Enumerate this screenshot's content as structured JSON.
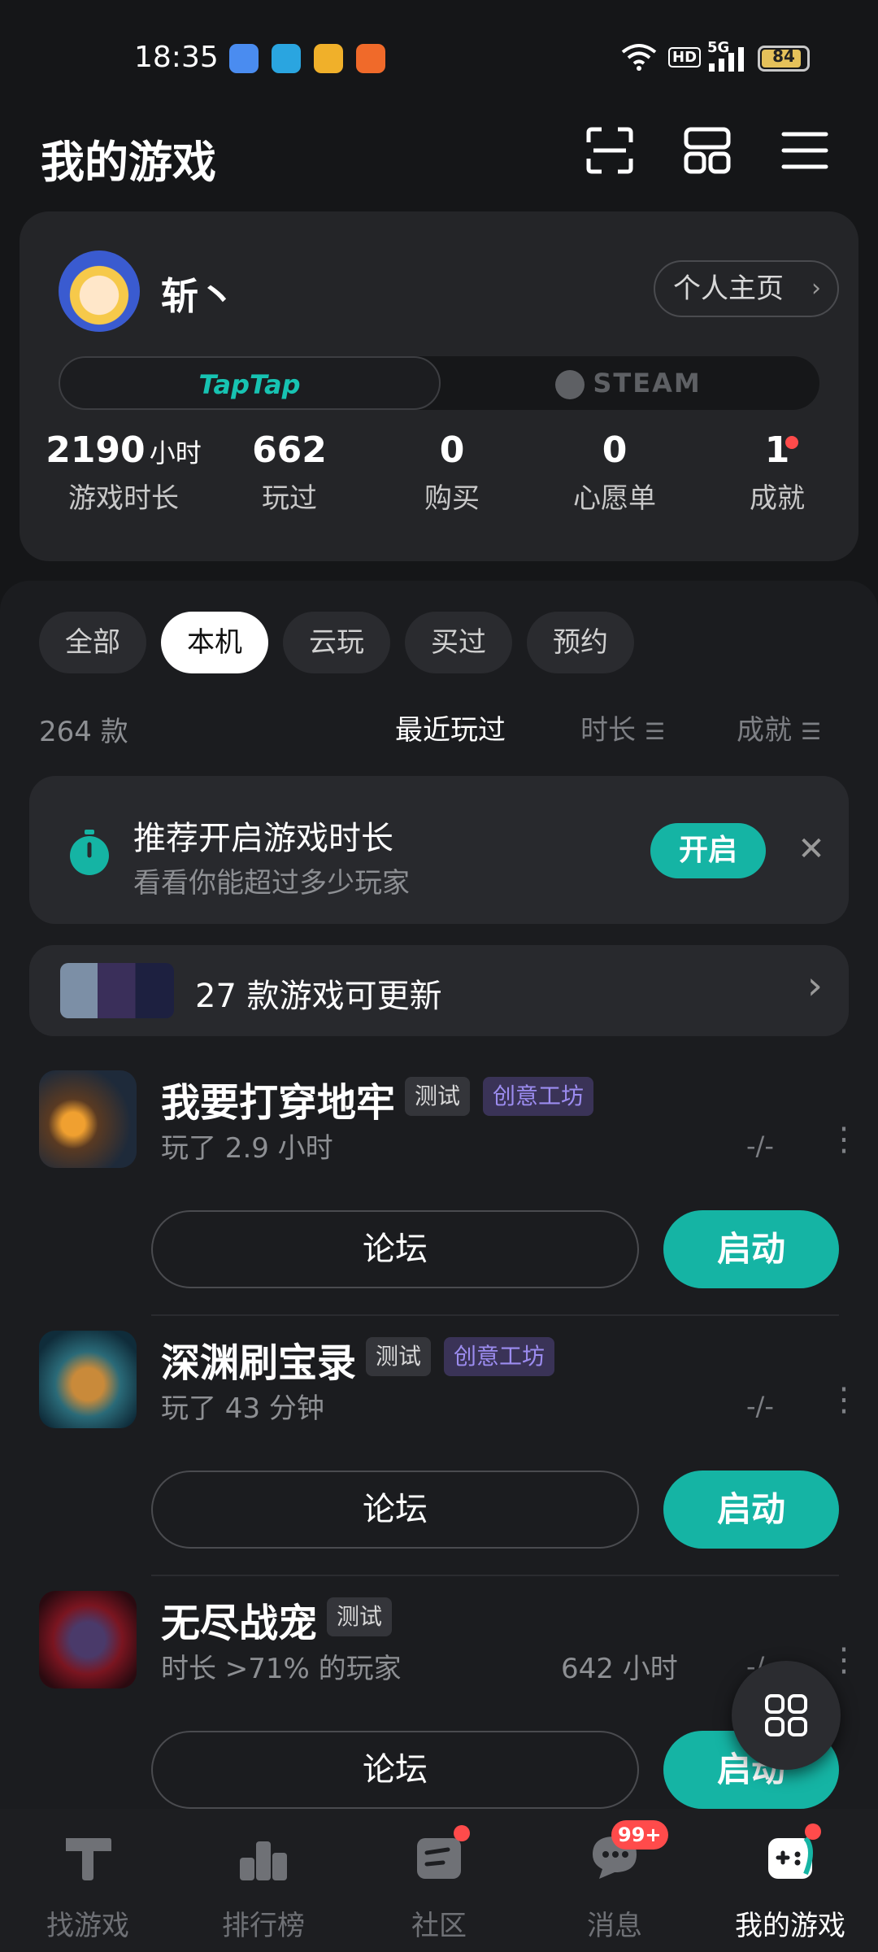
{
  "status_bar": {
    "time": "18:35",
    "network": "5G",
    "hd": "HD",
    "battery": "84"
  },
  "header": {
    "title": "我的游戏"
  },
  "profile": {
    "username": "斩丶",
    "home_button": "个人主页",
    "platforms": [
      "TapTap",
      "STEAM"
    ],
    "stats": [
      {
        "value": "2190",
        "unit": "小时",
        "label": "游戏时长"
      },
      {
        "value": "662",
        "unit": "",
        "label": "玩过"
      },
      {
        "value": "0",
        "unit": "",
        "label": "购买"
      },
      {
        "value": "0",
        "unit": "",
        "label": "心愿单"
      },
      {
        "value": "1",
        "unit": "",
        "label": "成就"
      }
    ]
  },
  "filters": {
    "chips": [
      "全部",
      "本机",
      "云玩",
      "买过",
      "预约"
    ],
    "active_chip": "本机",
    "count": "264 款",
    "sort": [
      "最近玩过",
      "时长",
      "成就"
    ]
  },
  "banner": {
    "title": "推荐开启游戏时长",
    "subtitle": "看看你能超过多少玩家",
    "button": "开启"
  },
  "updates": {
    "text": "27 款游戏可更新"
  },
  "games": [
    {
      "title": "我要打穿地牢",
      "tags": [
        "测试",
        "创意工坊"
      ],
      "played": "玩了 2.9 小时",
      "extra": "",
      "dash": "-/-",
      "forum": "论坛",
      "launch": "启动"
    },
    {
      "title": "深渊刷宝录",
      "tags": [
        "测试",
        "创意工坊"
      ],
      "played": "玩了 43 分钟",
      "extra": "",
      "dash": "-/-",
      "forum": "论坛",
      "launch": "启动"
    },
    {
      "title": "无尽战宠",
      "tags": [
        "测试"
      ],
      "played": "时长 >71% 的玩家",
      "extra": "642 小时",
      "dash": "-/-",
      "forum": "论坛",
      "launch": "启动"
    }
  ],
  "bottom_nav": {
    "items": [
      "找游戏",
      "排行榜",
      "社区",
      "消息",
      "我的游戏"
    ],
    "active": "我的游戏",
    "message_badge": "99+"
  },
  "colors": {
    "accent": "#15b4a4",
    "background": "#151618",
    "badge": "#ff4b4b",
    "workshop_tag": "#9c8cf0"
  }
}
